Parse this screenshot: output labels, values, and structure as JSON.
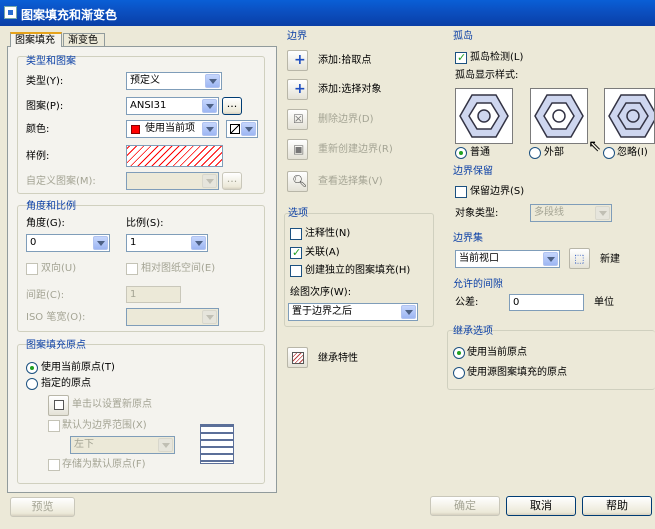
{
  "window": {
    "title": "图案填充和渐变色"
  },
  "tabs": {
    "hatch": "图案填充",
    "gradient": "渐变色"
  },
  "type_pattern": {
    "title": "类型和图案",
    "type_label": "类型(Y):",
    "type_value": "预定义",
    "pattern_label": "图案(P):",
    "pattern_value": "ANSI31",
    "browse": "...",
    "color_label": "颜色:",
    "color_value": "使用当前项",
    "swatch_label": "样例:",
    "custom_label": "自定义图案(M):",
    "color_swatch": "#ff0000"
  },
  "angle_scale": {
    "title": "角度和比例",
    "angle_label": "角度(G):",
    "angle_value": "0",
    "scale_label": "比例(S):",
    "scale_value": "1",
    "double_label": "双向(U)",
    "paper_label": "相对图纸空间(E)",
    "spacing_label": "间距(C):",
    "spacing_value": "1",
    "iso_label": "ISO 笔宽(O):"
  },
  "origin": {
    "title": "图案填充原点",
    "current_label": "使用当前原点(T)",
    "specified_label": "指定的原点",
    "click_label": "单击以设置新原点",
    "default_label": "默认为边界范围(X)",
    "position_value": "左下",
    "store_label": "存储为默认原点(F)"
  },
  "boundaries": {
    "title": "边界",
    "pick_points": "添加:拾取点",
    "select_objects": "添加:选择对象",
    "remove": "删除边界(D)",
    "recreate": "重新创建边界(R)",
    "view": "查看选择集(V)"
  },
  "options": {
    "title": "选项",
    "annotative": "注释性(N)",
    "associative": "关联(A)",
    "separate": "创建独立的图案填充(H)",
    "draw_order_label": "绘图次序(W):",
    "draw_order_value": "置于边界之后"
  },
  "inherit": {
    "label": "继承特性"
  },
  "islands": {
    "title": "孤岛",
    "detect_label": "孤岛检测(L)",
    "style_label": "孤岛显示样式:",
    "normal": "普通",
    "outer": "外部",
    "ignore": "忽略(I)"
  },
  "retention": {
    "title": "边界保留",
    "retain_label": "保留边界(S)",
    "type_label": "对象类型:",
    "type_value": "多段线"
  },
  "boundary_set": {
    "title": "边界集",
    "value": "当前视口",
    "new_label": "新建"
  },
  "gap": {
    "title": "允许的间隙",
    "tolerance_label": "公差:",
    "tolerance_value": "0",
    "unit": "单位"
  },
  "inherit_options": {
    "title": "继承选项",
    "use_current": "使用当前原点",
    "use_source": "使用源图案填充的原点"
  },
  "footer": {
    "preview": "预览",
    "ok": "确定",
    "cancel": "取消",
    "help": "帮助"
  }
}
